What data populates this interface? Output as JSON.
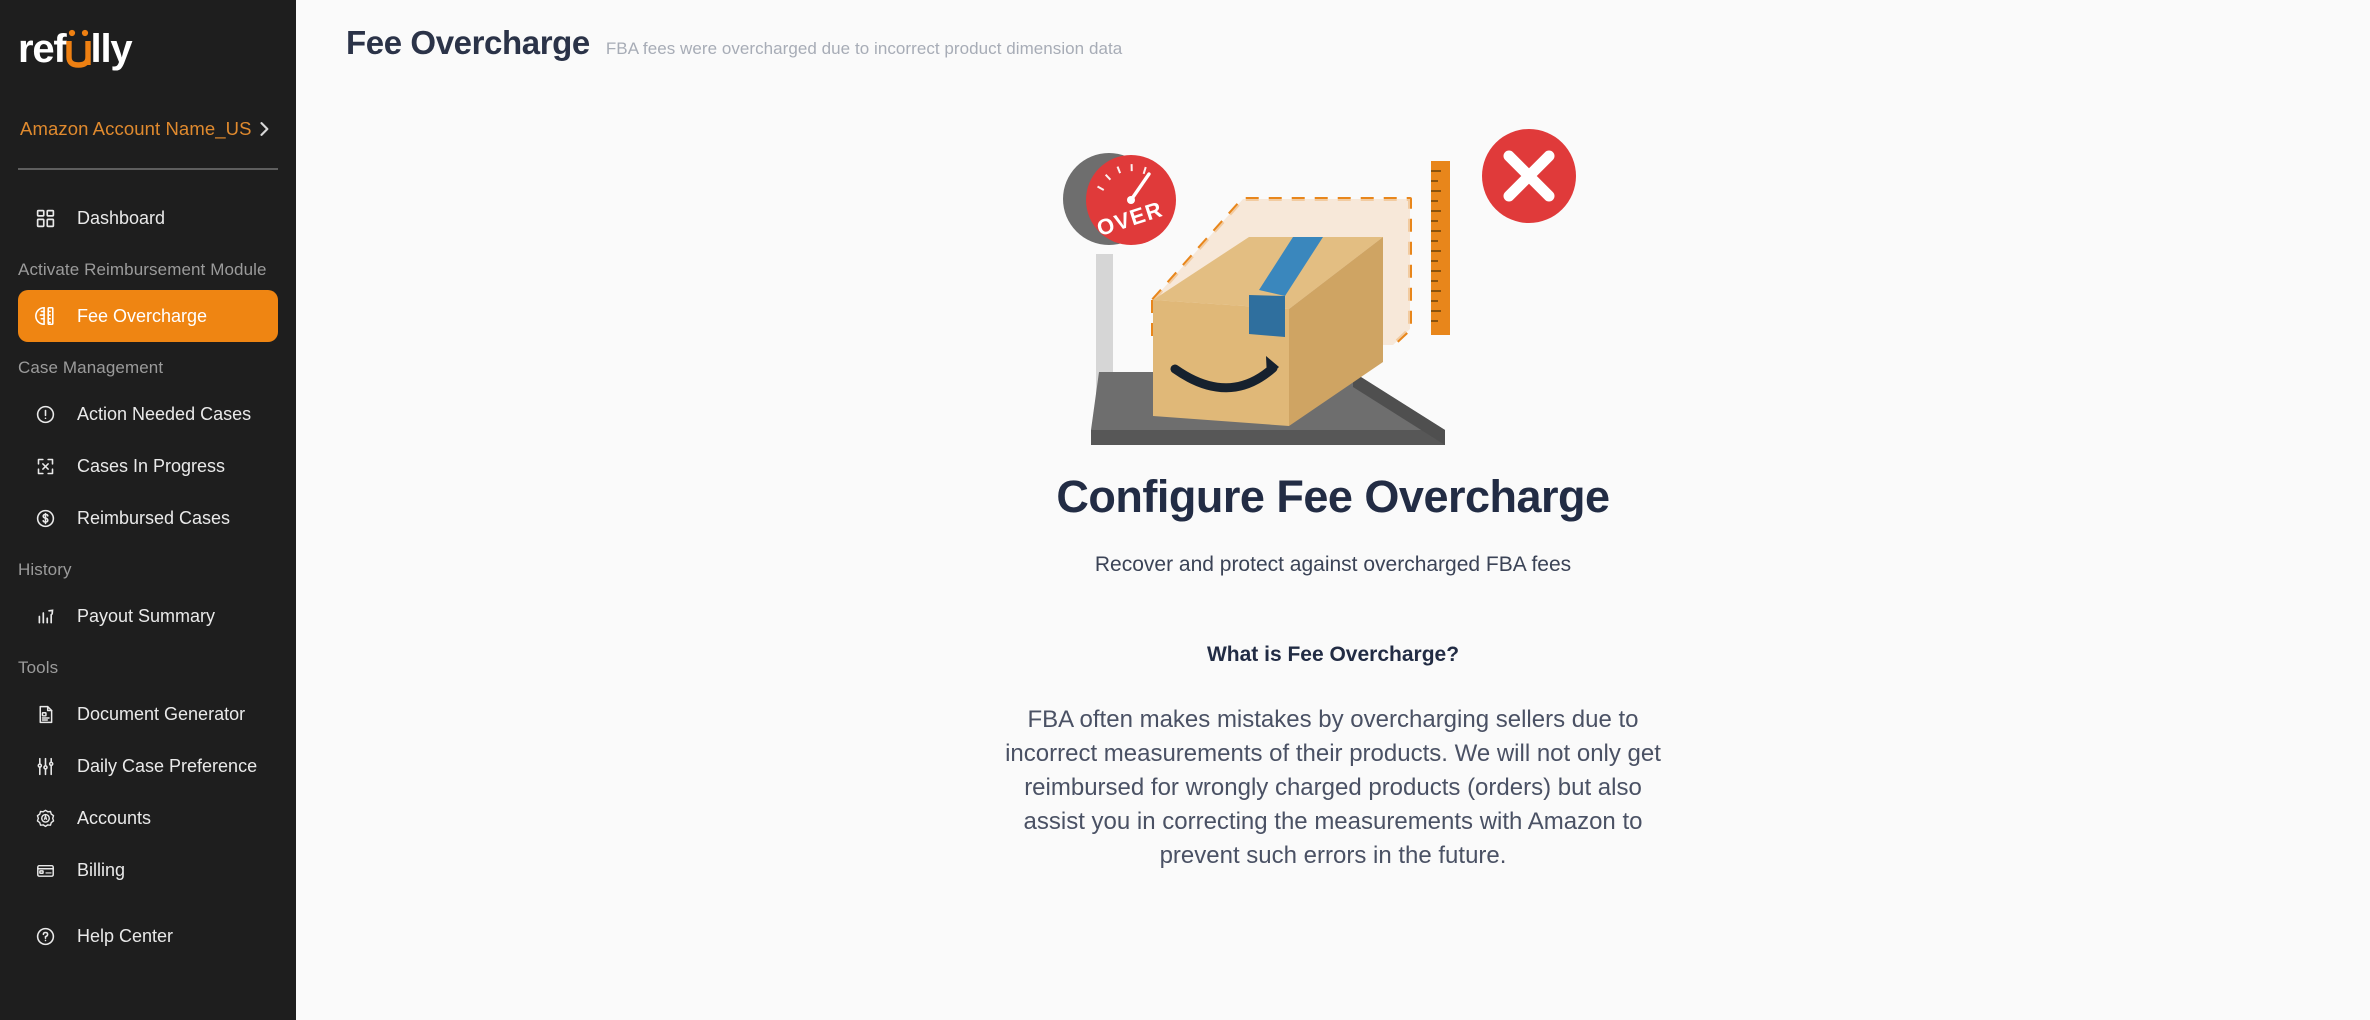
{
  "brand": {
    "logo_prefix": "ref",
    "logo_accent": "u",
    "logo_suffix": "lly",
    "accent_color": "#ee8012"
  },
  "sidebar": {
    "account": {
      "name": "Amazon Account Name_US",
      "chevron_icon": "chevron-right-icon"
    },
    "groups": [
      {
        "label": "",
        "items": [
          {
            "label": "Dashboard",
            "icon": "grid-dashboard-icon",
            "active": false
          }
        ]
      },
      {
        "label": "Activate Reimbursement Module",
        "items": [
          {
            "label": "Fee Overcharge",
            "icon": "ruler-protractor-icon",
            "active": true
          }
        ]
      },
      {
        "label": "Case Management",
        "items": [
          {
            "label": "Action Needed Cases",
            "icon": "alert-circle-icon",
            "active": false
          },
          {
            "label": "Cases In Progress",
            "icon": "expand-arrows-icon",
            "active": false
          },
          {
            "label": "Reimbursed Cases",
            "icon": "dollar-circle-icon",
            "active": false
          }
        ]
      },
      {
        "label": "History",
        "items": [
          {
            "label": "Payout Summary",
            "icon": "bar-chart-icon",
            "active": false
          }
        ]
      },
      {
        "label": "Tools",
        "items": [
          {
            "label": "Document Generator",
            "icon": "document-icon",
            "active": false
          },
          {
            "label": "Daily Case Preference",
            "icon": "sliders-icon",
            "active": false
          },
          {
            "label": "Accounts",
            "icon": "badge-gear-icon",
            "active": false
          },
          {
            "label": "Billing",
            "icon": "credit-card-icon",
            "active": false
          },
          {
            "label": "Help Center",
            "icon": "help-circle-icon",
            "active": false
          }
        ]
      }
    ]
  },
  "header": {
    "title": "Fee Overcharge",
    "subtitle": "FBA fees were overcharged due to incorrect product dimension data"
  },
  "main": {
    "illustration": {
      "name": "overcharge-scale-box-ruler-illustration",
      "scale_gauge_label": "OVER",
      "error_badge_icon": "x-circle-icon",
      "box_logo": "amazon-smile-icon"
    },
    "hero_title": "Configure Fee Overcharge",
    "hero_subtitle": "Recover and protect against overcharged FBA fees",
    "section_title": "What is Fee Overcharge?",
    "body_text": "FBA often makes mistakes by overcharging sellers due to incorrect measurements of their products. We will not only get reimbursed for wrongly charged products (orders) but also assist you in correcting the measurements with Amazon to prevent such errors in the future."
  },
  "colors": {
    "sidebar_bg": "#1e1e1e",
    "active_item": "#ef8512",
    "account_text": "#e08a2e",
    "page_bg": "#fafafa",
    "title_text": "#2b3348",
    "error_red": "#e03a3a",
    "box_tan": "#e0b878",
    "tape_blue": "#3a87bd"
  }
}
